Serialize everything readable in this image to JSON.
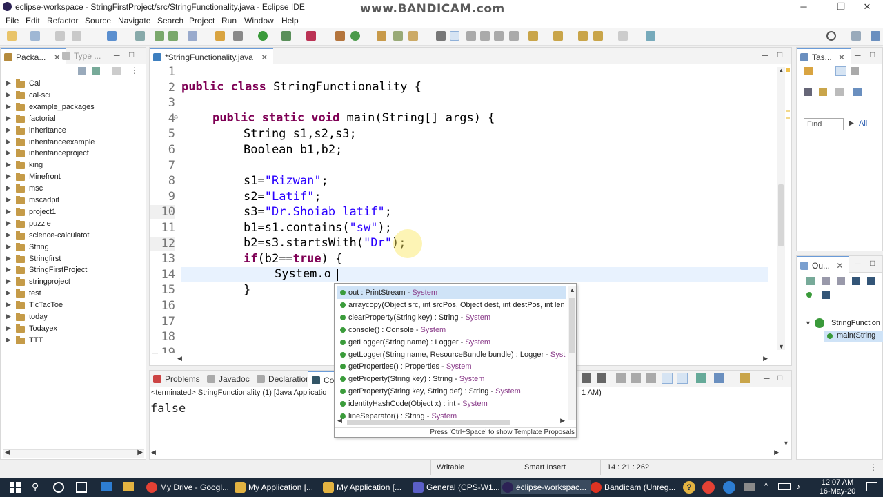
{
  "window": {
    "title": "eclipse-workspace - StringFirstProject/src/StringFunctionality.java - Eclipse IDE",
    "watermark": "www.BANDICAM.com"
  },
  "menu": [
    "File",
    "Edit",
    "Refactor",
    "Source",
    "Navigate",
    "Search",
    "Project",
    "Run",
    "Window",
    "Help"
  ],
  "package_explorer": {
    "tab_label": "Packa...",
    "tab2_label": "Type ...",
    "projects": [
      "Cal",
      "cal-sci",
      "example_packages",
      "factorial",
      "inheritance",
      "inheritanceexample",
      "inheritanceproject",
      "king",
      "Minefront",
      "msc",
      "mscadpit",
      "project1",
      "puzzle",
      "science-calculatot",
      "String",
      "Stringfirst",
      "StringFirstProject",
      "stringproject",
      "test",
      "TicTacToe",
      "today",
      "Todayex",
      "TTT"
    ]
  },
  "editor": {
    "tab_label": "*StringFunctionality.java",
    "lines": [
      {
        "n": "1"
      },
      {
        "n": "2"
      },
      {
        "n": "3"
      },
      {
        "n": "4"
      },
      {
        "n": "5"
      },
      {
        "n": "6"
      },
      {
        "n": "7"
      },
      {
        "n": "8"
      },
      {
        "n": "9"
      },
      {
        "n": "10"
      },
      {
        "n": "11"
      },
      {
        "n": "12"
      },
      {
        "n": "13"
      },
      {
        "n": "14"
      },
      {
        "n": "15"
      },
      {
        "n": "16"
      },
      {
        "n": "17"
      },
      {
        "n": "18"
      },
      {
        "n": "19"
      }
    ],
    "code": {
      "l2_kw": "public class",
      "l2_rest": " StringFunctionality {",
      "l4_kw": "public static void",
      "l4_rest": " main(String[] args) {",
      "l5": "String s1,s2,s3;",
      "l6": "Boolean b1,b2;",
      "l8_a": "s1=",
      "l8_s": "\"Rizwan\"",
      "l8_b": ";",
      "l9_a": "s2=",
      "l9_s": "\"Latif\"",
      "l9_b": ";",
      "l10_a": "s3=",
      "l10_s": "\"Dr.Shoiab latif\"",
      "l10_b": ";",
      "l11_a": "b1=s1.contains(",
      "l11_s": "\"sw\"",
      "l11_b": ");",
      "l12_a": "b2=s3.startsWith(",
      "l12_s": "\"Dr\"",
      "l12_b": ");",
      "l13_kw": "if",
      "l13_a": "(b2==",
      "l13_kw2": "true",
      "l13_b": ") {",
      "l14": "System.o",
      "l15": "}"
    }
  },
  "autocomplete": {
    "items": [
      {
        "text": "out : PrintStream - ",
        "cls": "System"
      },
      {
        "text": "arraycopy(Object src, int srcPos, Object dest, int destPos, int len",
        "cls": ""
      },
      {
        "text": "clearProperty(String key) : String - ",
        "cls": "System"
      },
      {
        "text": "console() : Console - ",
        "cls": "System"
      },
      {
        "text": "getLogger(String name) : Logger - ",
        "cls": "System"
      },
      {
        "text": "getLogger(String name, ResourceBundle bundle) : Logger - ",
        "cls": "Syst"
      },
      {
        "text": "getProperties() : Properties - ",
        "cls": "System"
      },
      {
        "text": "getProperty(String key) : String - ",
        "cls": "System"
      },
      {
        "text": "getProperty(String key, String def) : String - ",
        "cls": "System"
      },
      {
        "text": "identityHashCode(Object x) : int - ",
        "cls": "System"
      },
      {
        "text": "lineSeparator() : String - ",
        "cls": "System"
      }
    ],
    "footer": "Press 'Ctrl+Space' to show Template Proposals"
  },
  "bottom": {
    "tabs": [
      "Problems",
      "Javadoc",
      "Declaration",
      "Con"
    ],
    "terminated": "<terminated> StringFunctionality (1) [Java Applicatio",
    "terminated_tail": "1 AM)",
    "output": "false"
  },
  "tasks": {
    "tab_label": "Tas...",
    "find_placeholder": "Find",
    "all_label": "All"
  },
  "outline": {
    "tab_label": "Ou...",
    "class_label": "StringFunction",
    "method_label": "main(String"
  },
  "status": {
    "writable": "Writable",
    "insert": "Smart Insert",
    "position": "14 : 21 : 262"
  },
  "taskbar": {
    "items": [
      "My Drive - Googl...",
      "My Application [...",
      "My Application [...",
      "General (CPS-W1...",
      "eclipse-workspac...",
      "Bandicam (Unreg..."
    ],
    "time": "12:07 AM",
    "date": "16-May-20"
  },
  "colors": {
    "keyword": "#7f0055",
    "string": "#2a00ff",
    "taskbar": "#1c2a3a"
  }
}
